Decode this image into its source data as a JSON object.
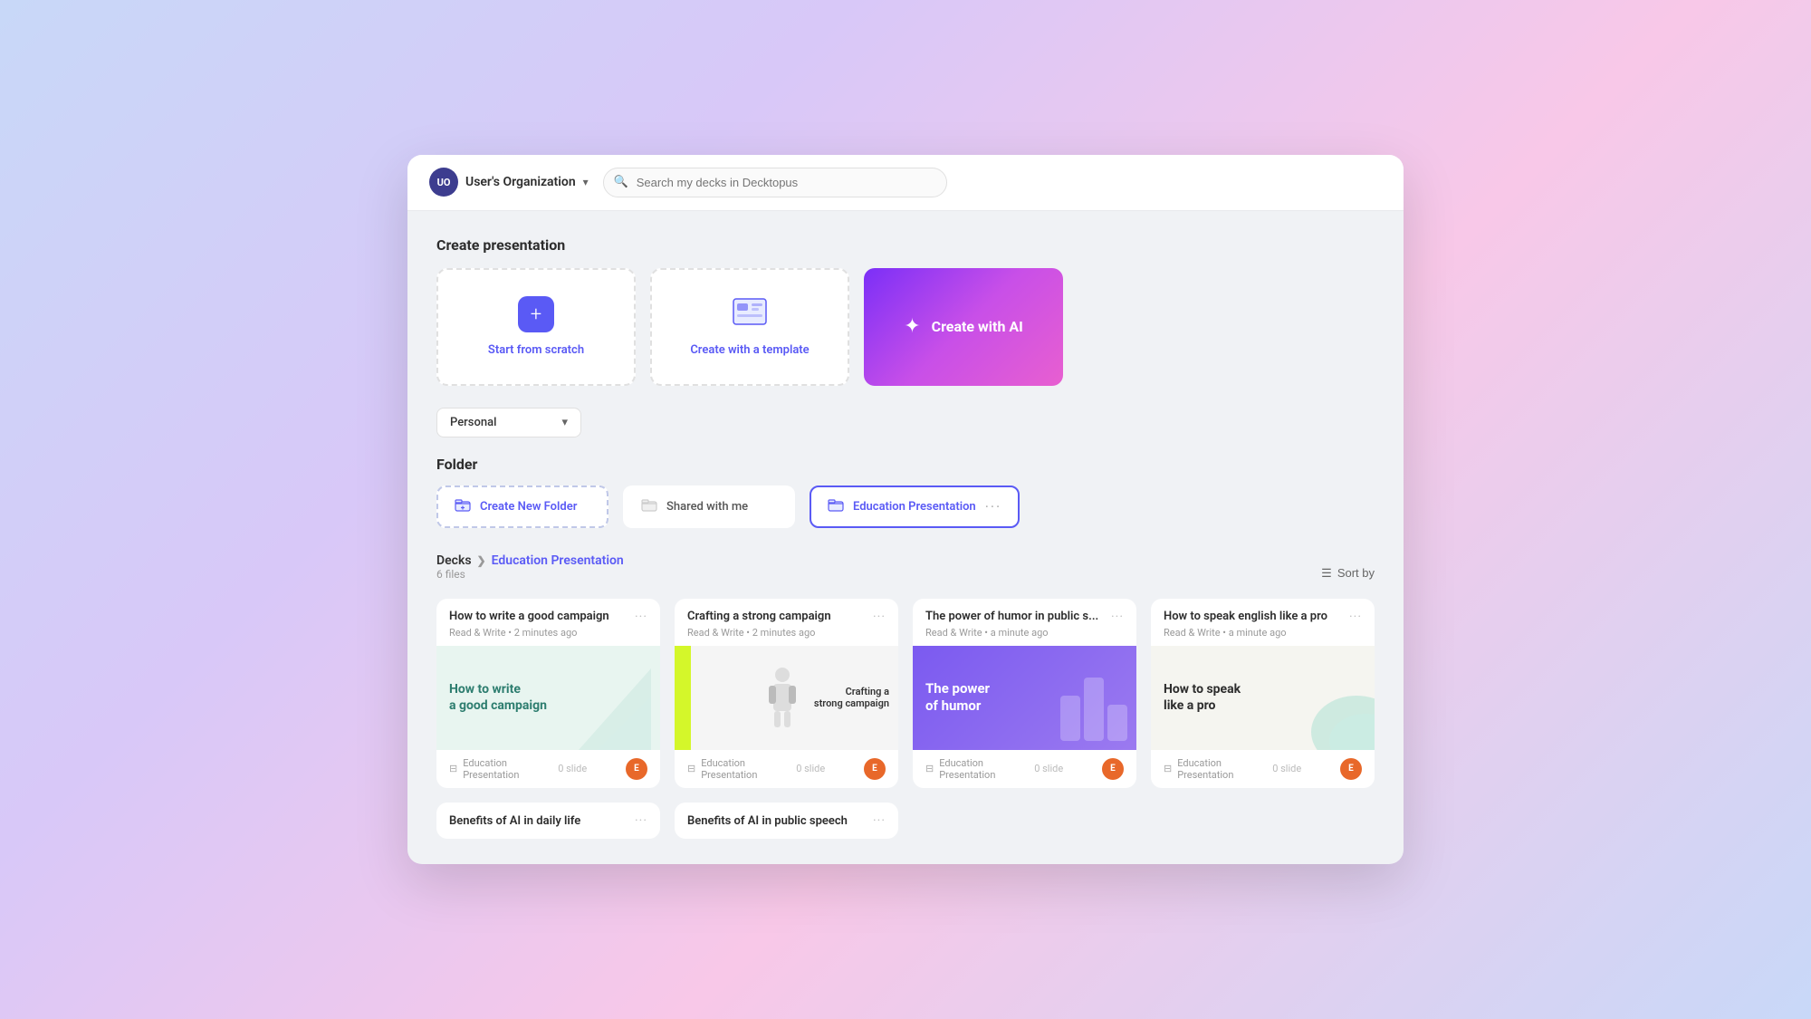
{
  "topbar": {
    "org_initials": "UO",
    "org_name": "User's Organization",
    "search_placeholder": "Search my decks in Decktopus"
  },
  "create_section": {
    "title": "Create presentation",
    "cards": [
      {
        "id": "scratch",
        "label": "Start from scratch"
      },
      {
        "id": "template",
        "label": "Create with a template"
      },
      {
        "id": "ai",
        "label": "Create with AI"
      }
    ]
  },
  "dropdown": {
    "value": "Personal"
  },
  "folder_section": {
    "title": "Folder",
    "items": [
      {
        "id": "new-folder",
        "label": "Create New Folder",
        "type": "dashed"
      },
      {
        "id": "shared",
        "label": "Shared with me",
        "type": "normal"
      },
      {
        "id": "education",
        "label": "Education Presentation",
        "type": "active"
      }
    ]
  },
  "decks_section": {
    "breadcrumb_main": "Decks",
    "breadcrumb_sub": "Education Presentation",
    "file_count": "6 files",
    "sort_label": "Sort by",
    "decks": [
      {
        "id": "deck1",
        "title": "How to write a good campaign",
        "meta": "Read & Write • 2 minutes ago",
        "folder": "Education\nPresentation",
        "slides": "0 slide",
        "thumb_type": "green",
        "thumb_text": "How to write a good campaign"
      },
      {
        "id": "deck2",
        "title": "Crafting a strong campaign",
        "meta": "Read & Write • 2 minutes ago",
        "folder": "Education\nPresentation",
        "slides": "0 slide",
        "thumb_type": "campaign",
        "thumb_text": "Crafting a strong campaign"
      },
      {
        "id": "deck3",
        "title": "The power of humor in public s...",
        "meta": "Read & Write • a minute ago",
        "folder": "Education\nPresentation",
        "slides": "0 slide",
        "thumb_type": "purple",
        "thumb_text": "The power of humor"
      },
      {
        "id": "deck4",
        "title": "How to speak english like a pro",
        "meta": "Read & Write • a minute ago",
        "folder": "Education\nPresentation",
        "slides": "0 slide",
        "thumb_type": "speak",
        "thumb_text": "How to speak like a pro"
      }
    ],
    "bottom_decks": [
      {
        "id": "deck5",
        "title": "Benefits of AI in daily life"
      },
      {
        "id": "deck6",
        "title": "Benefits of AI in public speech"
      }
    ]
  }
}
